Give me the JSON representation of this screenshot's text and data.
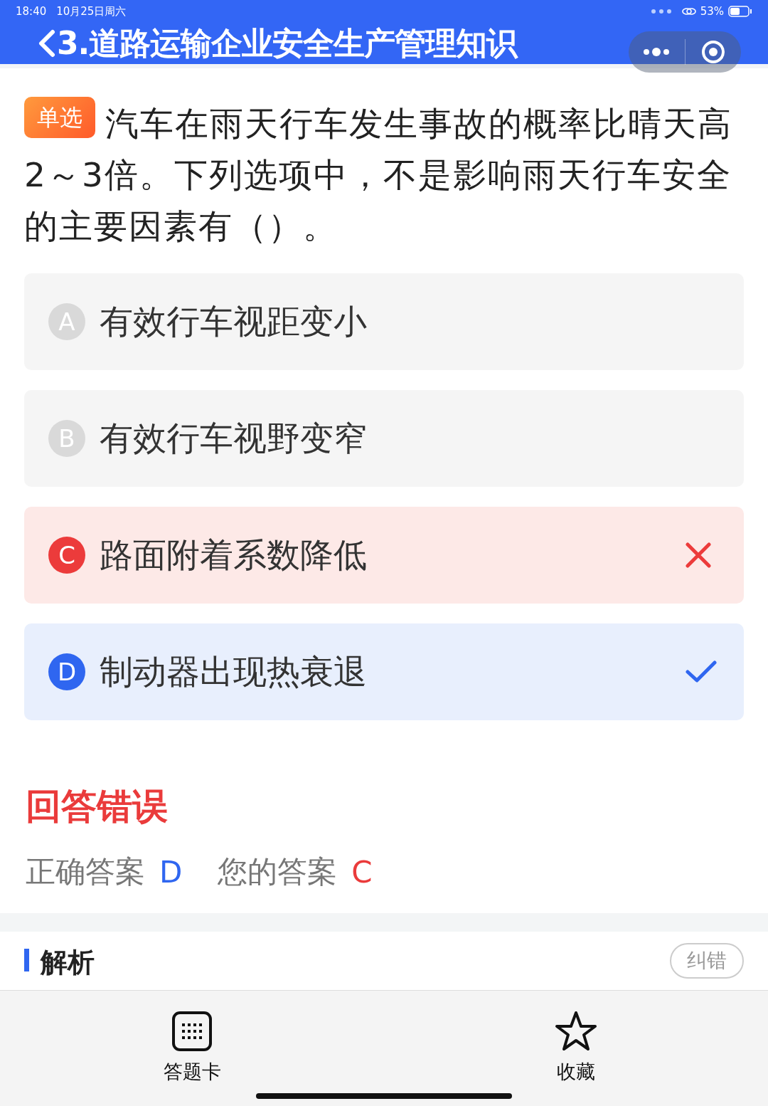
{
  "status_bar": {
    "time": "18:40",
    "date": "10月25日周六",
    "battery": "53%"
  },
  "header": {
    "title": "3.道路运输企业安全生产管理知识"
  },
  "question": {
    "type_tag": "单选",
    "text_lines": [
      "汽车在雨天行车发生事故的概率比晴天高",
      "2～3倍。下列选项中，不是影响雨天行车安全的主要因素有（）。"
    ]
  },
  "options": [
    {
      "letter": "A",
      "text": "有效行车视距变小",
      "wrong": false,
      "correct": false
    },
    {
      "letter": "B",
      "text": "有效行车视野变窄",
      "wrong": false,
      "correct": false
    },
    {
      "letter": "C",
      "text": "路面附着系数降低",
      "wrong": true,
      "correct": false
    },
    {
      "letter": "D",
      "text": "制动器出现热衰退",
      "wrong": false,
      "correct": true
    }
  ],
  "result": {
    "title": "回答错误",
    "correct_label": "正确答案",
    "correct": "D",
    "yours_label": "您的答案",
    "yours": "C"
  },
  "analysis": {
    "title": "解析",
    "report_button": "纠错"
  },
  "bottom_bar": [
    {
      "kind": "card",
      "label": "答题卡"
    },
    {
      "kind": "favorite",
      "label": "收藏"
    }
  ]
}
